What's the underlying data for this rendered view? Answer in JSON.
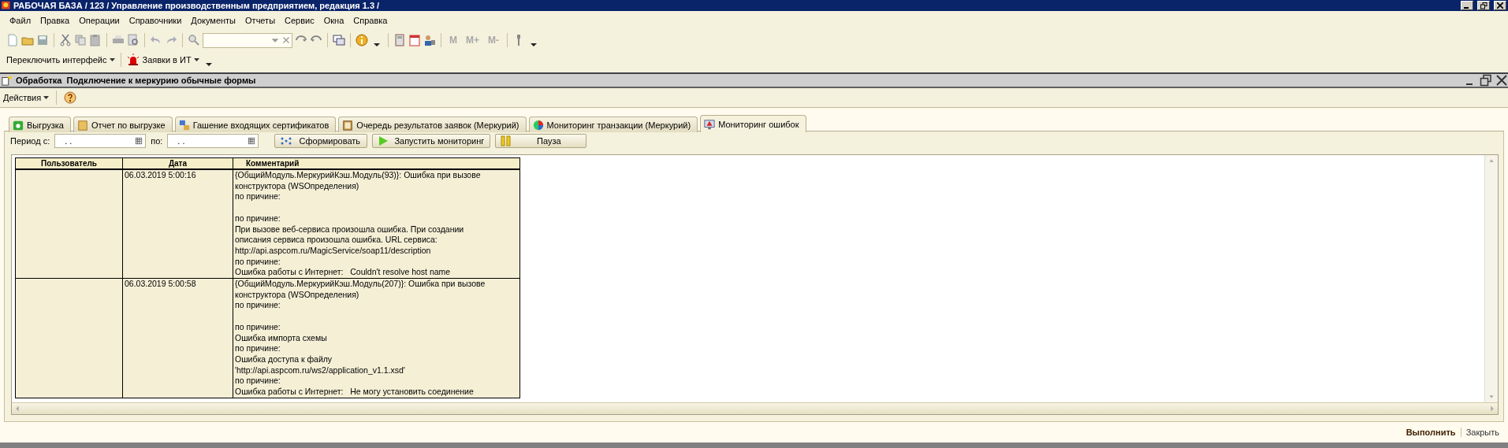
{
  "window": {
    "title": "РАБОЧАЯ БАЗА / 123 /  Управление производственным предприятием, редакция 1.3 /"
  },
  "menu": [
    "Файл",
    "Правка",
    "Операции",
    "Справочники",
    "Документы",
    "Отчеты",
    "Сервис",
    "Окна",
    "Справка"
  ],
  "toolbar": {
    "memory_buttons": [
      {
        "label": "M",
        "disabled": true
      },
      {
        "label": "M+",
        "disabled": true
      },
      {
        "label": "M-",
        "disabled": true
      }
    ]
  },
  "toolbar2": [
    "Переключить интерфейс",
    "Заявки в ИТ"
  ],
  "form": {
    "kind_label": "Обработка",
    "title": "Подключение к меркурию обычные формы",
    "actions": "Действия"
  },
  "tabs": [
    {
      "label": "Выгрузка",
      "selected": false
    },
    {
      "label": "Отчет по выгрузке",
      "selected": false
    },
    {
      "label": "Гашение входящих сертификатов",
      "selected": false
    },
    {
      "label": "Очередь результатов заявок (Меркурий)",
      "selected": false
    },
    {
      "label": "Мониторинг транзакции (Меркурий)",
      "selected": false
    },
    {
      "label": "Мониторинг ошибок",
      "selected": true
    }
  ],
  "period": {
    "from_label": "Период с:",
    "from_value": ". .",
    "to_label": "по:",
    "to_value": ". ."
  },
  "buttons": [
    "Сформировать",
    "Запустить мониторинг",
    "Пауза"
  ],
  "table": {
    "columns": [
      "Пользователь",
      "Дата",
      "Комментарий"
    ],
    "rows": [
      {
        "user": "",
        "date": "06.03.2019 5:00:16",
        "comment": "{ОбщийМодуль.МеркурийКэш.Модуль(93)}: Ошибка при вызове\nконструктора (WSОпределения)\nпо причине:\n\nпо причине:\nПри вызове веб-сервиса произошла ошибка. При создании\nописания сервиса произошла ошибка. URL сервиса:\nhttp://api.aspcom.ru/MagicService/soap11/description\nпо причине:\nОшибка работы с Интернет:   Couldn't resolve host name"
      },
      {
        "user": "",
        "date": "06.03.2019 5:00:58",
        "comment": "{ОбщийМодуль.МеркурийКэш.Модуль(207)}: Ошибка при вызове\nконструктора (WSОпределения)\nпо причине:\n\nпо причине:\nОшибка импорта схемы\nпо причине:\nОшибка доступа к файлу\n'http://api.aspcom.ru/ws2/application_v1.1.xsd'\nпо причине:\nОшибка работы с Интернет:   Не могу установить соединение"
      }
    ]
  },
  "footer": [
    "Выполнить",
    "Закрыть"
  ]
}
